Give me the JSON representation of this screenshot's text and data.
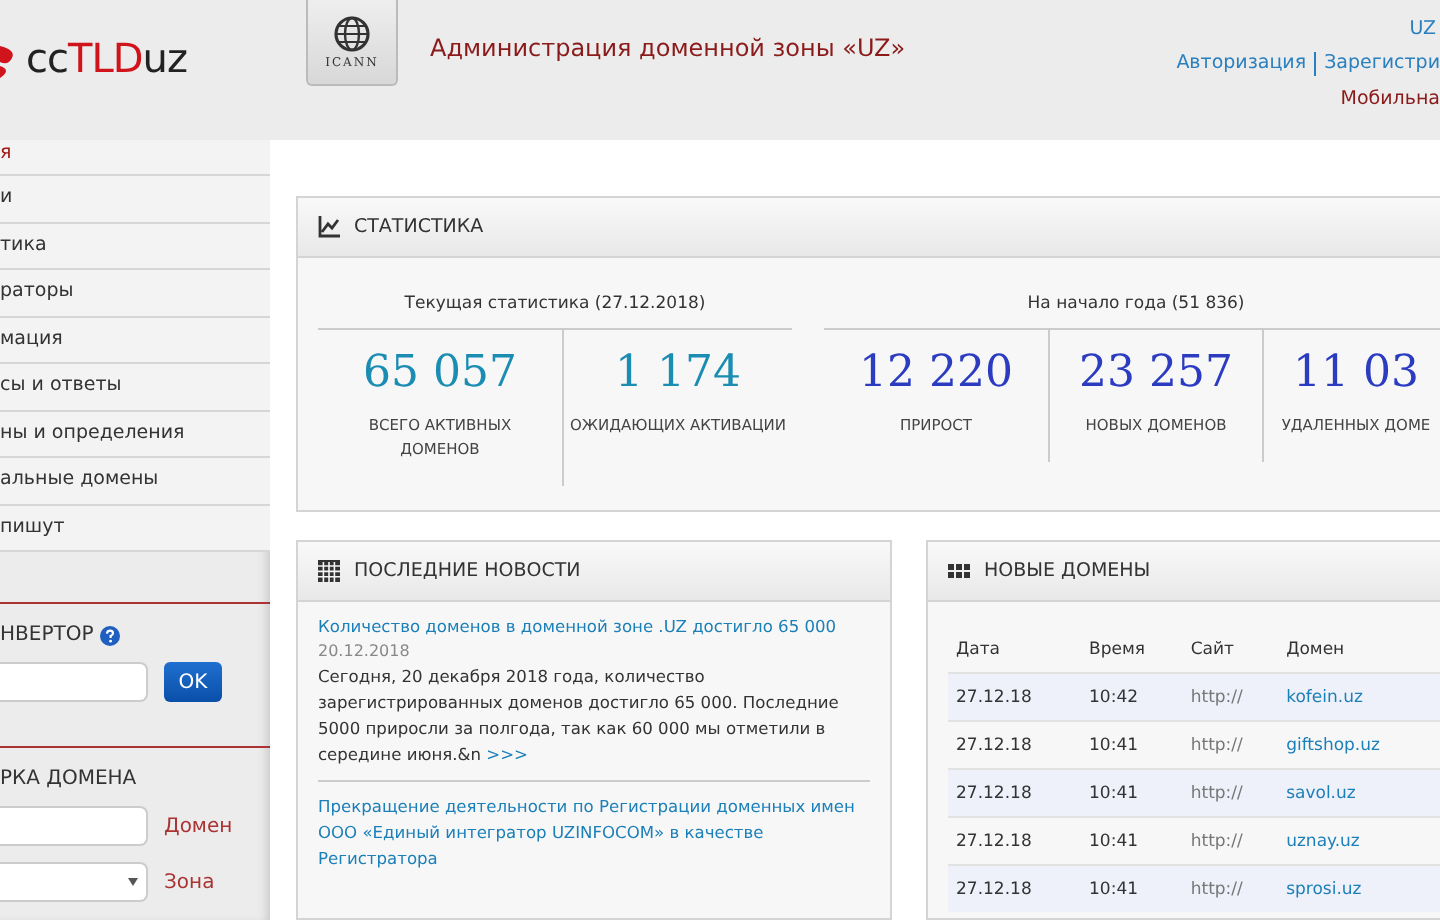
{
  "header": {
    "logo": {
      "prefix": "cc",
      "highlight": "TLD",
      "suffix": "uz"
    },
    "icann_label": "ICANN",
    "title": "Администрация доменной зоны «UZ»",
    "language": "UZ",
    "links": [
      {
        "label": "Авторизация"
      },
      {
        "label": "Зарегистри"
      }
    ],
    "mobile_link": "Мобильна"
  },
  "sidebar": {
    "items": [
      {
        "label": "я",
        "selected": true
      },
      {
        "label": "и",
        "selected": false
      },
      {
        "label": "тика",
        "selected": false
      },
      {
        "label": "раторы",
        "selected": false
      },
      {
        "label": "мация",
        "selected": false
      },
      {
        "label": "сы и ответы",
        "selected": false
      },
      {
        "label": "ны и определения",
        "selected": false
      },
      {
        "label": "альные домены",
        "selected": false
      },
      {
        "label": "пишут",
        "selected": false
      }
    ],
    "converter": {
      "title": "НВЕРТОР",
      "button": "OK"
    },
    "domain_check": {
      "title": "РКА ДОМЕНА",
      "domain_label": "Домен",
      "zone_label": "Зона"
    }
  },
  "statistics": {
    "title": "СТАТИСТИКА",
    "groups": [
      {
        "caption": "Текущая статистика (27.12.2018)",
        "kind": "current",
        "items": [
          {
            "value": "65 057",
            "label": "ВСЕГО АКТИВНЫХ ДОМЕНОВ"
          },
          {
            "value": "1 174",
            "label": "ОЖИДАЮЩИХ АКТИВАЦИИ"
          }
        ]
      },
      {
        "caption": "На начало года (51 836)",
        "kind": "yearly",
        "items": [
          {
            "value": "12 220",
            "label": "ПРИРОСТ"
          },
          {
            "value": "23 257",
            "label": "НОВЫХ ДОМЕНОВ"
          },
          {
            "value": "11 03",
            "label": "УДАЛЕННЫХ ДОМЕ"
          }
        ]
      }
    ]
  },
  "news": {
    "title": "ПОСЛЕДНИЕ НОВОСТИ",
    "items": [
      {
        "headline": "Количество доменов в доменной зоне .UZ достигло 65 000",
        "date": "20.12.2018",
        "text": "Сегодня, 20 декабря 2018 года, количество зарегистрированных доменов достигло 65 000. Последние 5000 приросли за полгода, так как 60 000 мы отметили в середине июня.&n",
        "more": ">>>"
      },
      {
        "headline": "Прекращение деятельности по Регистрации доменных имен ООО «Единый интегратор UZINFOCOM» в качестве Регистратора"
      }
    ]
  },
  "new_domains": {
    "title": "НОВЫЕ ДОМЕНЫ",
    "columns": [
      "Дата",
      "Время",
      "Сайт",
      "Домен"
    ],
    "rows": [
      [
        "27.12.18",
        "10:42",
        "http://",
        "kofein.uz"
      ],
      [
        "27.12.18",
        "10:41",
        "http://",
        "giftshop.uz"
      ],
      [
        "27.12.18",
        "10:41",
        "http://",
        "savol.uz"
      ],
      [
        "27.12.18",
        "10:41",
        "http://",
        "uznay.uz"
      ],
      [
        "27.12.18",
        "10:41",
        "http://",
        "sprosi.uz"
      ]
    ]
  }
}
